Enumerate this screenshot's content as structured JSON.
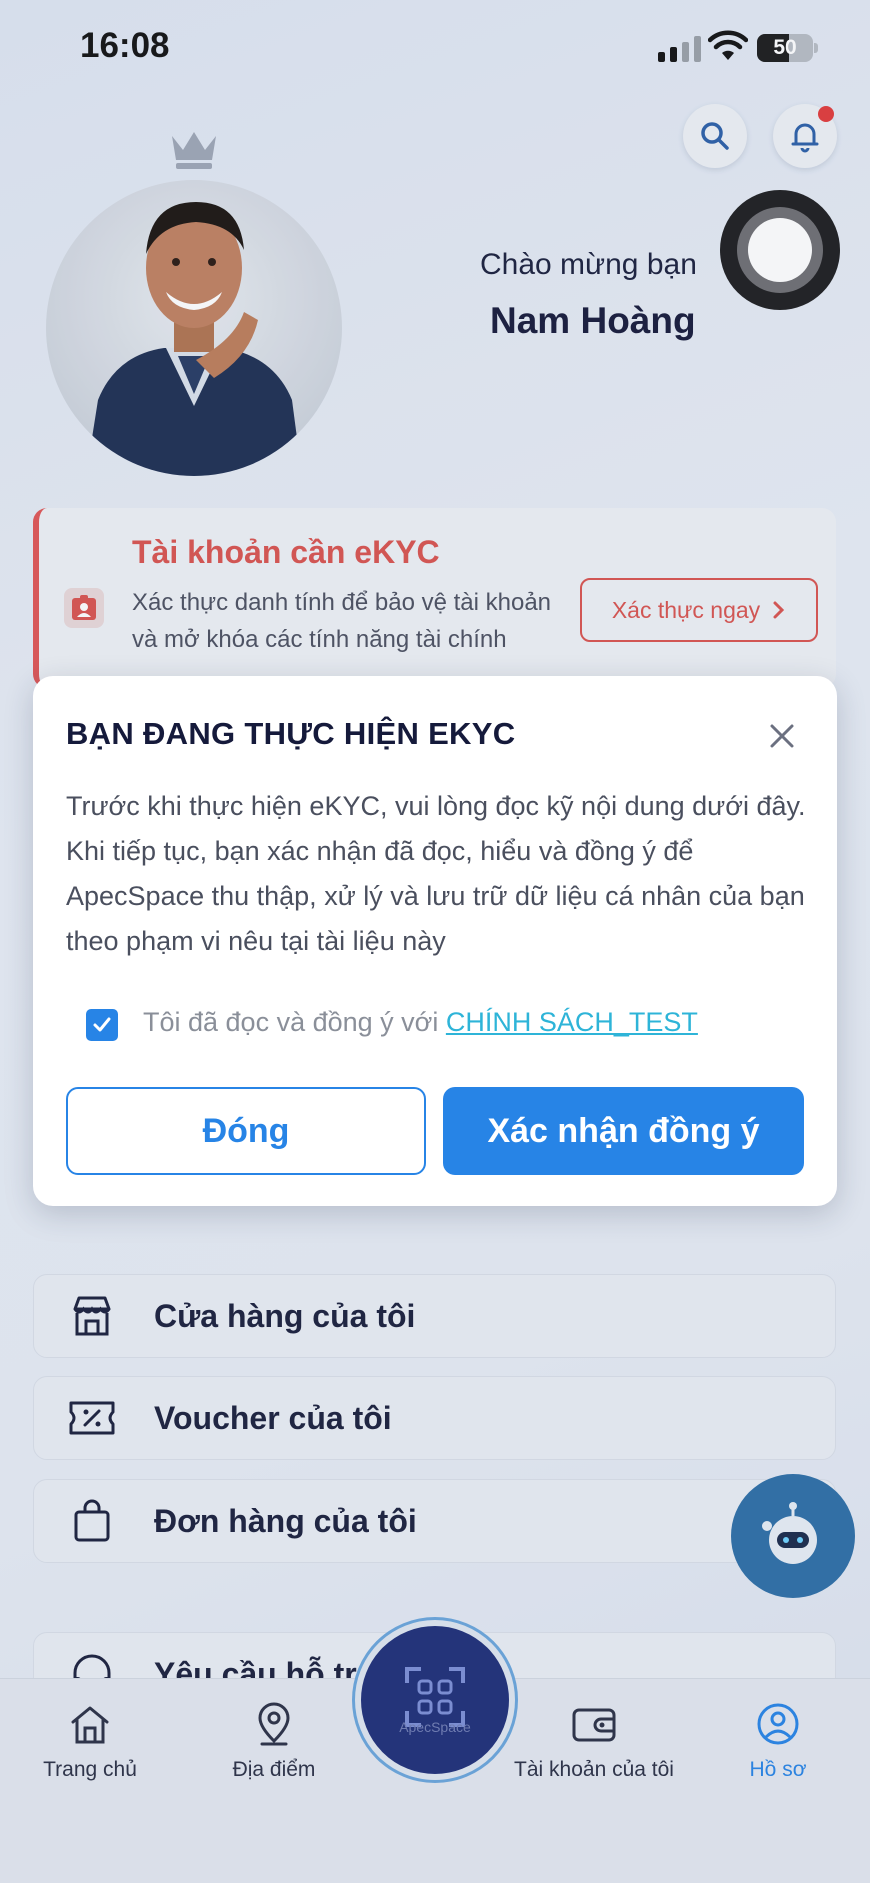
{
  "status_bar": {
    "time": "16:08",
    "battery": "50"
  },
  "profile": {
    "welcome": "Chào mừng bạn",
    "name": "Nam Hoàng"
  },
  "ekyc_card": {
    "title": "Tài khoản cần eKYC",
    "description": "Xác thực danh tính để bảo vệ tài khoản và mở khóa các tính năng tài chính",
    "button": "Xác thực ngay",
    "accent": "#d9534f"
  },
  "modal": {
    "title": "BẠN ĐANG THỰC HIỆN EKYC",
    "body": "Trước khi thực hiện eKYC, vui lòng đọc kỹ nội dung dưới đây. Khi tiếp tục, bạn xác nhận đã đọc, hiểu và đồng ý để ApecSpace thu thập, xử lý và lưu trữ dữ liệu cá nhân của bạn theo phạm vi nêu tại tài liệu này",
    "checkbox_checked": true,
    "agree_text": "Tôi đã đọc và đồng ý với ",
    "agree_link": "CHÍNH SÁCH_TEST",
    "close_button": "Đóng",
    "confirm_button": "Xác nhận đồng ý",
    "accent": "#2784e6"
  },
  "menu": [
    {
      "label": "Cửa hàng của tôi",
      "icon": "store-icon"
    },
    {
      "label": "Voucher của tôi",
      "icon": "voucher-icon"
    },
    {
      "label": "Đơn hàng của tôi",
      "icon": "shopping-bag-icon"
    },
    {
      "label": "Yêu cầu hỗ trợ",
      "icon": "headset-icon"
    }
  ],
  "bottom_nav": {
    "home": "Trang chủ",
    "place": "Địa điểm",
    "center": "ApecSpace",
    "account": "Tài khoản của tôi",
    "profile": "Hồ sơ"
  }
}
